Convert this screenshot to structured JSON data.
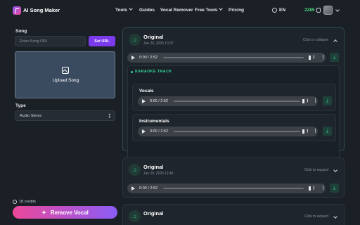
{
  "header": {
    "brand": "AI Song Maker",
    "nav": [
      {
        "label": "Tools",
        "dropdown": true
      },
      {
        "label": "Guides",
        "dropdown": false
      },
      {
        "label": "Vocal Remover",
        "dropdown": false
      },
      {
        "label": "Free Tools",
        "dropdown": true
      },
      {
        "label": "Pricing",
        "dropdown": false
      }
    ],
    "language": "EN",
    "credits": "2285"
  },
  "left": {
    "song_label": "Song",
    "song_placeholder": "Enter Song URL",
    "set_url_label": "Set URL",
    "upload_label": "Upload Song",
    "type_label": "Type",
    "type_value": "Audio Stems",
    "credits_text": "18 credits",
    "remove_vocal_label": "Remove Vocal"
  },
  "cards": [
    {
      "title": "Original",
      "date": "Jun 20, 2025 13:37",
      "toggle": "Click to collapse",
      "time": "0:00 / 2:52",
      "karaoke": {
        "title": "KARAOKE TRACK",
        "stems": [
          {
            "label": "Vocals",
            "time": "0:00 / 2:52"
          },
          {
            "label": "Instrumentals",
            "time": "0:00 / 2:52"
          }
        ]
      }
    },
    {
      "title": "Original",
      "date": "Jun 20, 2025 11:40",
      "toggle": "Click to expand",
      "time": "0:00 / 2:52"
    },
    {
      "title": "Original",
      "toggle": "Click to expand"
    }
  ],
  "colors": {
    "accent_purple": "#7c3aed",
    "accent_green": "#34d399",
    "credits_green": "#4ade80",
    "gradient_start": "#ec4899",
    "gradient_end": "#8b5cf6"
  }
}
